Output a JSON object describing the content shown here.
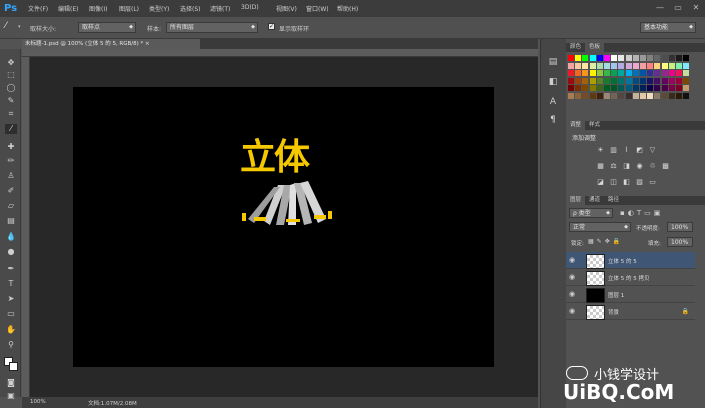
{
  "app": {
    "logo": "Ps"
  },
  "menu": [
    "文件(F)",
    "编辑(E)",
    "图像(I)",
    "图层(L)",
    "类型(Y)",
    "选择(S)",
    "滤镜(T)",
    "3D(D)",
    "视图(V)",
    "窗口(W)",
    "帮助(H)"
  ],
  "window_controls": {
    "minimize": "—",
    "restore": "▭",
    "close": "✕"
  },
  "options": {
    "sample_size_label": "取样大小:",
    "sample_size_value": "取样点",
    "sample_label": "样本:",
    "sample_value": "所有图层",
    "show_ring_label": "显示取样环",
    "show_ring_checked": true,
    "workspace_value": "基本功能"
  },
  "document": {
    "tab_title": "未标题-1.psd @ 100% (立体 5  的  5, RGB/8) *",
    "tab_close": "×"
  },
  "canvas": {
    "main_text": "立体",
    "text_color": "#f5c800"
  },
  "status": {
    "zoom": "100%",
    "doc_info": "文档:1.07M/2.08M"
  },
  "swatches_panel": {
    "tabs": [
      "颜色",
      "色板"
    ],
    "active": "色板"
  },
  "adjustments_panel": {
    "tabs": [
      "调整",
      "样式"
    ],
    "active": "调整",
    "title": "添加调整"
  },
  "layers_panel": {
    "tabs": [
      "图层",
      "通道",
      "路径"
    ],
    "active": "图层",
    "filter_label": "ρ 类型",
    "blend_mode": "正常",
    "opacity_label": "不透明度:",
    "opacity_value": "100%",
    "lock_label": "锁定:",
    "fill_label": "填充:",
    "fill_value": "100%",
    "layers": [
      {
        "name": "立体  5  的  5",
        "thumb": "checker",
        "selected": true
      },
      {
        "name": "立体  5  的  5 拷贝",
        "thumb": "checker",
        "selected": false
      },
      {
        "name": "图层 1",
        "thumb": "black",
        "selected": false
      },
      {
        "name": "背景",
        "thumb": "checker",
        "selected": false,
        "locked": true
      }
    ]
  },
  "watermark": {
    "line1": "小钱学设计",
    "line2": "UiBQ.CoM"
  }
}
